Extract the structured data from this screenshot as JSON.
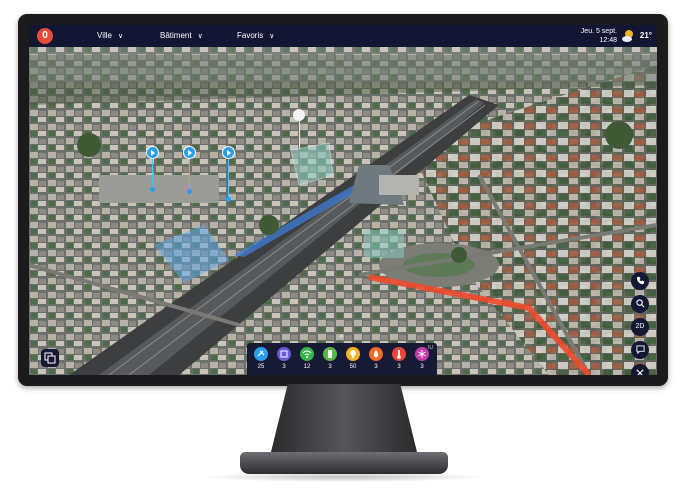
{
  "top_bar": {
    "logo_text": "0",
    "nav": [
      {
        "label": "Ville"
      },
      {
        "label": "Bâtiment"
      },
      {
        "label": "Favoris"
      }
    ],
    "date": "Jeu. 5 sept.",
    "time": "12:48",
    "weather_icon": "sun-cloud-icon",
    "temperature": "21°"
  },
  "right_tools": [
    {
      "icon": "phone-icon",
      "label": ""
    },
    {
      "icon": "search-icon",
      "label": ""
    },
    {
      "icon": "",
      "label": "2D"
    },
    {
      "icon": "chat-icon",
      "label": ""
    },
    {
      "icon": "close-icon",
      "label": ""
    }
  ],
  "sensor_bar": {
    "corner_label": "IU",
    "sensors": [
      {
        "icon": "satellite-icon",
        "color": "#2c9fea",
        "count": "25"
      },
      {
        "icon": "building-icon",
        "color": "#6b5bd6",
        "count": "3"
      },
      {
        "icon": "wifi-icon",
        "color": "#3ab34a",
        "count": "12"
      },
      {
        "icon": "battery-icon",
        "color": "#54b948",
        "count": "3"
      },
      {
        "icon": "lightbulb-icon",
        "color": "#f5b323",
        "count": "50"
      },
      {
        "icon": "fire-icon",
        "color": "#f06b2a",
        "count": "3"
      },
      {
        "icon": "thermometer-icon",
        "color": "#e8463a",
        "count": "3"
      },
      {
        "icon": "snowflake-icon",
        "color": "#c33ea7",
        "count": "3"
      }
    ]
  },
  "colors": {
    "navy": "#121633",
    "brand": "#e84b3a",
    "poi": "#2c9fea",
    "route": "#ee4a2e"
  }
}
